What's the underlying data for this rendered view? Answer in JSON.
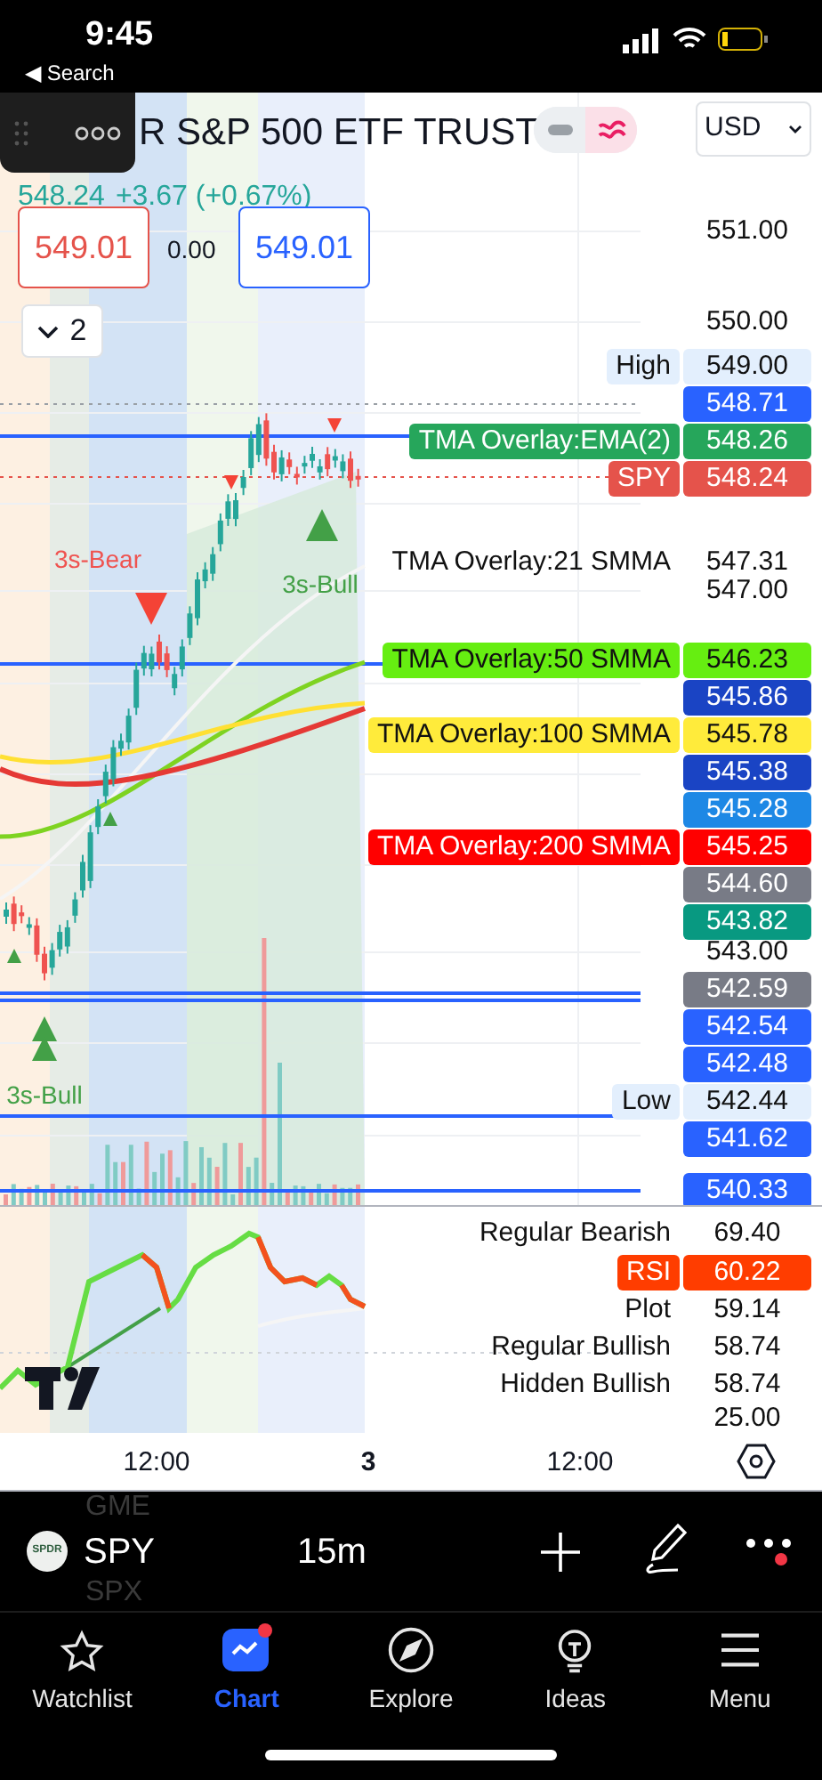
{
  "status_bar": {
    "time": "9:45",
    "back": "◀ Search"
  },
  "header": {
    "title": "R S&P 500 ETF TRUST",
    "price": "548.24",
    "change": "+3.67 (+0.67%)",
    "currency": "USD",
    "sell": "549.01",
    "spread": "0.00",
    "buy": "549.01",
    "indicator_count": "2"
  },
  "mode_toggle": [
    {
      "kind": "minus",
      "selected": false
    },
    {
      "kind": "wave",
      "selected": true
    }
  ],
  "chart_labels": [
    {
      "text": "3s-Bear",
      "kind": "bear"
    },
    {
      "text": "3s-Bull",
      "kind": "bull"
    },
    {
      "text": "3s-Bull",
      "kind": "bull"
    }
  ],
  "price_axis": [
    {
      "value": "551.00",
      "kind": "plain"
    },
    {
      "value": "550.00",
      "kind": "plain"
    },
    {
      "value": "549.00",
      "kind": "tag",
      "color": "#e3effd",
      "label": {
        "text": "High",
        "color": "#e3effd"
      }
    },
    {
      "value": "548.71",
      "kind": "tag",
      "color": "#2962ff"
    },
    {
      "value": "548.26",
      "kind": "tag",
      "color": "#26a65b",
      "label": {
        "text": "TMA Overlay:EMA(2)",
        "color": "#26a65b"
      }
    },
    {
      "value": "548.24",
      "kind": "tag",
      "color": "#e5534b",
      "label": {
        "text": "SPY",
        "color": "#e5534b"
      }
    },
    {
      "value": "547.31",
      "kind": "plain",
      "label": {
        "text": "TMA Overlay:21 SMMA"
      }
    },
    {
      "value": "547.00",
      "kind": "plain"
    },
    {
      "value": "546.23",
      "kind": "tag",
      "color": "#66ee11",
      "label": {
        "text": "TMA Overlay:50 SMMA",
        "color": "#66ee11"
      }
    },
    {
      "value": "545.86",
      "kind": "tag",
      "color": "#1a44c4"
    },
    {
      "value": "545.78",
      "kind": "tag",
      "color": "#ffeb3b",
      "label": {
        "text": "TMA Overlay:100 SMMA",
        "color": "#ffeb3b"
      }
    },
    {
      "value": "545.38",
      "kind": "tag",
      "color": "#1a44c4"
    },
    {
      "value": "545.28",
      "kind": "tag",
      "color": "#1e88e5"
    },
    {
      "value": "545.25",
      "kind": "tag",
      "color": "#ff0000",
      "label": {
        "text": "TMA Overlay:200 SMMA",
        "color": "#ff0000"
      }
    },
    {
      "value": "544.60",
      "kind": "tag",
      "color": "#787b86"
    },
    {
      "value": "543.82",
      "kind": "tag",
      "color": "#089981"
    },
    {
      "value": "543.00",
      "kind": "plain"
    },
    {
      "value": "542.59",
      "kind": "tag",
      "color": "#787b86"
    },
    {
      "value": "542.54",
      "kind": "tag",
      "color": "#2962ff"
    },
    {
      "value": "542.48",
      "kind": "tag",
      "color": "#2962ff"
    },
    {
      "value": "542.44",
      "kind": "tag",
      "color": "#e3effd",
      "label": {
        "text": "Low",
        "color": "#e3effd"
      }
    },
    {
      "value": "541.62",
      "kind": "tag",
      "color": "#2962ff"
    },
    {
      "value": "540.33",
      "kind": "tag",
      "color": "#2962ff"
    }
  ],
  "rsi_axis": [
    {
      "value": "69.40",
      "kind": "plain",
      "label": {
        "text": "Regular Bearish"
      }
    },
    {
      "value": "60.22",
      "kind": "tag",
      "color": "#ff3d00",
      "label": {
        "text": "RSI",
        "color": "#ff3d00"
      }
    },
    {
      "value": "59.14",
      "kind": "plain",
      "label": {
        "text": "Plot"
      }
    },
    {
      "value": "58.74",
      "kind": "plain",
      "label": {
        "text": "Regular Bullish"
      }
    },
    {
      "value": "58.74",
      "kind": "plain",
      "label": {
        "text": "Hidden Bullish"
      }
    },
    {
      "value": "25.00",
      "kind": "plain"
    }
  ],
  "time_axis": [
    {
      "text": "12:00",
      "bold": false
    },
    {
      "text": "3",
      "bold": true
    },
    {
      "text": "12:00",
      "bold": false
    }
  ],
  "toolbar": {
    "symbol_above": "GME",
    "symbol": "SPY",
    "symbol_below": "SPX",
    "logo": "SPDR",
    "interval": "15m"
  },
  "tab_bar": [
    {
      "label": "Watchlist",
      "selected": false
    },
    {
      "label": "Chart",
      "selected": true
    },
    {
      "label": "Explore",
      "selected": false
    },
    {
      "label": "Ideas",
      "selected": false
    },
    {
      "label": "Menu",
      "selected": false
    }
  ]
}
